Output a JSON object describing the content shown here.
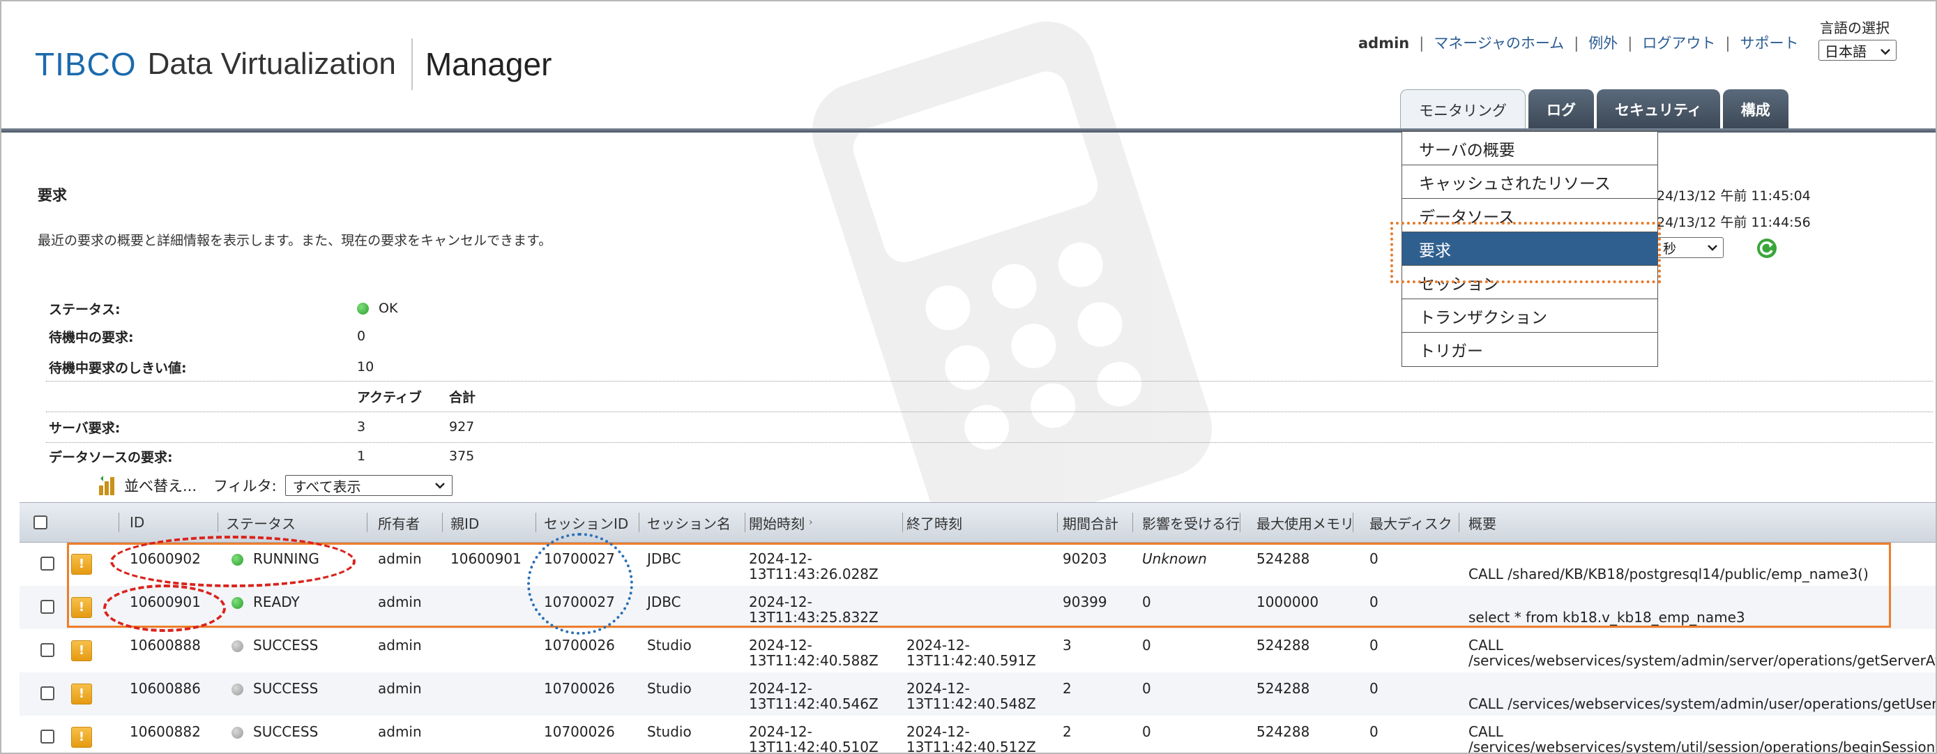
{
  "header": {
    "logo_brand": "TIBCO",
    "logo_product": "Data Virtualization",
    "logo_app": "Manager"
  },
  "top_links": {
    "user": "admin",
    "manager_home": "マネージャのホーム",
    "exceptions": "例外",
    "logout": "ログアウト",
    "support": "サポート"
  },
  "language": {
    "label": "言語の選択",
    "selected": "日本語"
  },
  "tabs": [
    {
      "label": "モニタリング",
      "active": true
    },
    {
      "label": "ログ",
      "active": false
    },
    {
      "label": "セキュリティ",
      "active": false
    },
    {
      "label": "構成",
      "active": false
    }
  ],
  "monitoring_menu": {
    "items": [
      {
        "label": "サーバの概要",
        "selected": false
      },
      {
        "label": "キャッシュされたリソース",
        "selected": false
      },
      {
        "label": "データソース",
        "selected": false
      },
      {
        "label": "要求",
        "selected": true
      },
      {
        "label": "セッション",
        "selected": false
      },
      {
        "label": "トランザクション",
        "selected": false
      },
      {
        "label": "トリガー",
        "selected": false
      }
    ]
  },
  "right_panel": {
    "time1": "24/13/12 午前 11:45:04",
    "time2": "24/13/12 午前 11:44:56",
    "refresh_select": "秒"
  },
  "page": {
    "title": "要求",
    "description": "最近の要求の概要と詳細情報を表示します。また、現在の要求をキャンセルできます。"
  },
  "status": {
    "status_label": "ステータス:",
    "status_value": "OK",
    "waiting_label": "待機中の要求:",
    "waiting_value": "0",
    "threshold_label": "待機中要求のしきい値:",
    "threshold_value": "10",
    "active_header": "アクティブ",
    "total_header": "合計",
    "server_label": "サーバ要求:",
    "server_active": "3",
    "server_total": "927",
    "datasource_label": "データソースの要求:",
    "datasource_active": "1",
    "datasource_total": "375"
  },
  "toolbar": {
    "sort_label": "並べ替え...",
    "filter_label": "フィルタ:",
    "filter_value": "すべて表示"
  },
  "grid": {
    "columns": [
      "ID",
      "ステータス",
      "所有者",
      "親ID",
      "セッションID",
      "セッション名",
      "開始時刻",
      "終了時刻",
      "期間合計",
      "影響を受ける行",
      "最大使用メモリ",
      "最大ディスク",
      "概要"
    ],
    "rows": [
      {
        "id": "10600902",
        "status": "RUNNING",
        "status_color": "green",
        "owner": "admin",
        "parent": "10600901",
        "session_id": "10700027",
        "session_name": "JDBC",
        "start1": "2024-12-",
        "start2": "13T11:43:26.028Z",
        "end1": "",
        "end2": "",
        "duration": "90203",
        "rows": "Unknown",
        "memory": "524288",
        "disk": "0",
        "summary1": "",
        "summary2": "CALL /shared/KB/KB18/postgresql14/public/emp_name3()"
      },
      {
        "id": "10600901",
        "status": "READY",
        "status_color": "green",
        "owner": "admin",
        "parent": "",
        "session_id": "10700027",
        "session_name": "JDBC",
        "start1": "2024-12-",
        "start2": "13T11:43:25.832Z",
        "end1": "",
        "end2": "",
        "duration": "90399",
        "rows": "0",
        "memory": "1000000",
        "disk": "0",
        "summary1": "",
        "summary2": "select * from kb18.v_kb18_emp_name3"
      },
      {
        "id": "10600888",
        "status": "SUCCESS",
        "status_color": "gray",
        "owner": "admin",
        "parent": "",
        "session_id": "10700026",
        "session_name": "Studio",
        "start1": "2024-12-",
        "start2": "13T11:42:40.588Z",
        "end1": "2024-12-",
        "end2": "13T11:42:40.591Z",
        "duration": "3",
        "rows": "0",
        "memory": "524288",
        "disk": "0",
        "summary1": "CALL",
        "summary2": "/services/webservices/system/admin/server/operations/getServerAt"
      },
      {
        "id": "10600886",
        "status": "SUCCESS",
        "status_color": "gray",
        "owner": "admin",
        "parent": "",
        "session_id": "10700026",
        "session_name": "Studio",
        "start1": "2024-12-",
        "start2": "13T11:42:40.546Z",
        "end1": "2024-12-",
        "end2": "13T11:42:40.548Z",
        "duration": "2",
        "rows": "0",
        "memory": "524288",
        "disk": "0",
        "summary1": "",
        "summary2": "CALL /services/webservices/system/admin/user/operations/getUser"
      },
      {
        "id": "10600882",
        "status": "SUCCESS",
        "status_color": "gray",
        "owner": "admin",
        "parent": "",
        "session_id": "10700026",
        "session_name": "Studio",
        "start1": "2024-12-",
        "start2": "13T11:42:40.510Z",
        "end1": "2024-12-",
        "end2": "13T11:42:40.512Z",
        "duration": "2",
        "rows": "0",
        "memory": "524288",
        "disk": "0",
        "summary1": "CALL",
        "summary2": "/services/webservices/system/util/session/operations/beginSession"
      }
    ]
  },
  "colors": {
    "brand_blue": "#1b6aac",
    "selected_menu": "#2f5f8f",
    "highlight_orange": "#ee7d2a",
    "highlight_red": "#d9231c",
    "highlight_blue": "#2a6fb7",
    "status_ok": "#2b9e2b"
  }
}
